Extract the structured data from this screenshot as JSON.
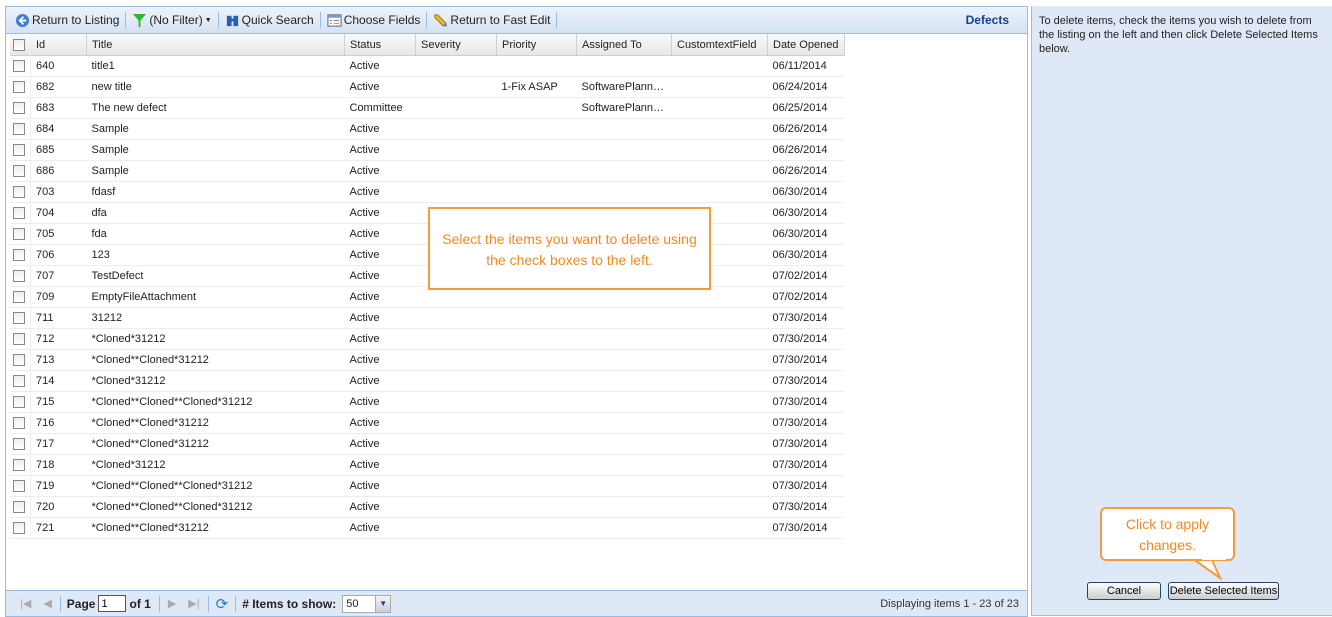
{
  "toolbar": {
    "return_listing": "Return to Listing",
    "filter": "(No Filter)",
    "quick_search": "Quick Search",
    "choose_fields": "Choose Fields",
    "fast_edit": "Return to Fast Edit",
    "title": "Defects"
  },
  "columns": [
    "Id",
    "Title",
    "Status",
    "Severity",
    "Priority",
    "Assigned To",
    "CustomtextField",
    "Date Opened"
  ],
  "rows": [
    [
      "640",
      "title1",
      "Active",
      "",
      "",
      "",
      "",
      "06/11/2014"
    ],
    [
      "682",
      "new title",
      "Active",
      "",
      "1-Fix ASAP",
      "SoftwarePlann…",
      "",
      "06/24/2014"
    ],
    [
      "683",
      "The new defect",
      "Committee",
      "",
      "",
      "SoftwarePlann…",
      "",
      "06/25/2014"
    ],
    [
      "684",
      "Sample",
      "Active",
      "",
      "",
      "",
      "",
      "06/26/2014"
    ],
    [
      "685",
      "Sample",
      "Active",
      "",
      "",
      "",
      "",
      "06/26/2014"
    ],
    [
      "686",
      "Sample",
      "Active",
      "",
      "",
      "",
      "",
      "06/26/2014"
    ],
    [
      "703",
      "fdasf",
      "Active",
      "",
      "",
      "",
      "",
      "06/30/2014"
    ],
    [
      "704",
      "dfa",
      "Active",
      "",
      "",
      "",
      "",
      "06/30/2014"
    ],
    [
      "705",
      "fda",
      "Active",
      "",
      "",
      "",
      "",
      "06/30/2014"
    ],
    [
      "706",
      "123",
      "Active",
      "",
      "",
      "",
      "",
      "06/30/2014"
    ],
    [
      "707",
      "TestDefect",
      "Active",
      "",
      "",
      "",
      "",
      "07/02/2014"
    ],
    [
      "709",
      "EmptyFileAttachment",
      "Active",
      "",
      "",
      "",
      "",
      "07/02/2014"
    ],
    [
      "711",
      "31212",
      "Active",
      "",
      "",
      "",
      "",
      "07/30/2014"
    ],
    [
      "712",
      "*Cloned*31212",
      "Active",
      "",
      "",
      "",
      "",
      "07/30/2014"
    ],
    [
      "713",
      "*Cloned**Cloned*31212",
      "Active",
      "",
      "",
      "",
      "",
      "07/30/2014"
    ],
    [
      "714",
      "*Cloned*31212",
      "Active",
      "",
      "",
      "",
      "",
      "07/30/2014"
    ],
    [
      "715",
      "*Cloned**Cloned**Cloned*31212",
      "Active",
      "",
      "",
      "",
      "",
      "07/30/2014"
    ],
    [
      "716",
      "*Cloned**Cloned*31212",
      "Active",
      "",
      "",
      "",
      "",
      "07/30/2014"
    ],
    [
      "717",
      "*Cloned**Cloned*31212",
      "Active",
      "",
      "",
      "",
      "",
      "07/30/2014"
    ],
    [
      "718",
      "*Cloned*31212",
      "Active",
      "",
      "",
      "",
      "",
      "07/30/2014"
    ],
    [
      "719",
      "*Cloned**Cloned**Cloned*31212",
      "Active",
      "",
      "",
      "",
      "",
      "07/30/2014"
    ],
    [
      "720",
      "*Cloned**Cloned**Cloned*31212",
      "Active",
      "",
      "",
      "",
      "",
      "07/30/2014"
    ],
    [
      "721",
      "*Cloned**Cloned*31212",
      "Active",
      "",
      "",
      "",
      "",
      "07/30/2014"
    ]
  ],
  "footer": {
    "page_label": "Page",
    "page_value": "1",
    "of_label": "of 1",
    "items_label": "# Items to show:",
    "items_value": "50",
    "display": "Displaying items 1 - 23 of 23"
  },
  "right": {
    "instructions": "To delete items, check the items you wish to delete from the listing on the left and then click Delete Selected Items below.",
    "cancel": "Cancel",
    "delete": "Delete Selected Items"
  },
  "callouts": {
    "select": "Select the items you want to delete using the check boxes to the left.",
    "apply": "Click to apply changes."
  }
}
